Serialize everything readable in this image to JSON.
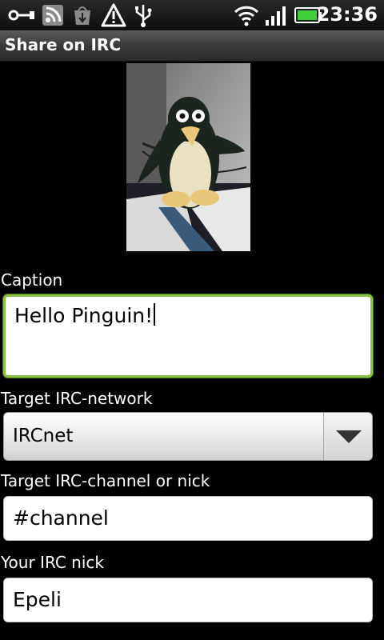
{
  "status_bar": {
    "icons": [
      "usb-connection-icon",
      "rss-feed-icon",
      "download-complete-icon",
      "warning-icon",
      "usb-debugging-icon",
      "wifi-icon",
      "signal-strength-icon",
      "battery-icon"
    ],
    "time": "23:36"
  },
  "app": {
    "title": "Share on IRC"
  },
  "photo": {
    "subject": "knitted-penguin-photo"
  },
  "form": {
    "caption": {
      "label": "Caption",
      "value": "Hello Pinguin!"
    },
    "network": {
      "label": "Target IRC-network",
      "value": "IRCnet"
    },
    "channel": {
      "label": "Target IRC-channel or nick",
      "value": "#channel"
    },
    "nick": {
      "label": "Your IRC nick",
      "value": "Epeli"
    }
  },
  "colors": {
    "focus_border": "#8ac43f",
    "background": "#000000",
    "battery": "#3fcf3a"
  }
}
